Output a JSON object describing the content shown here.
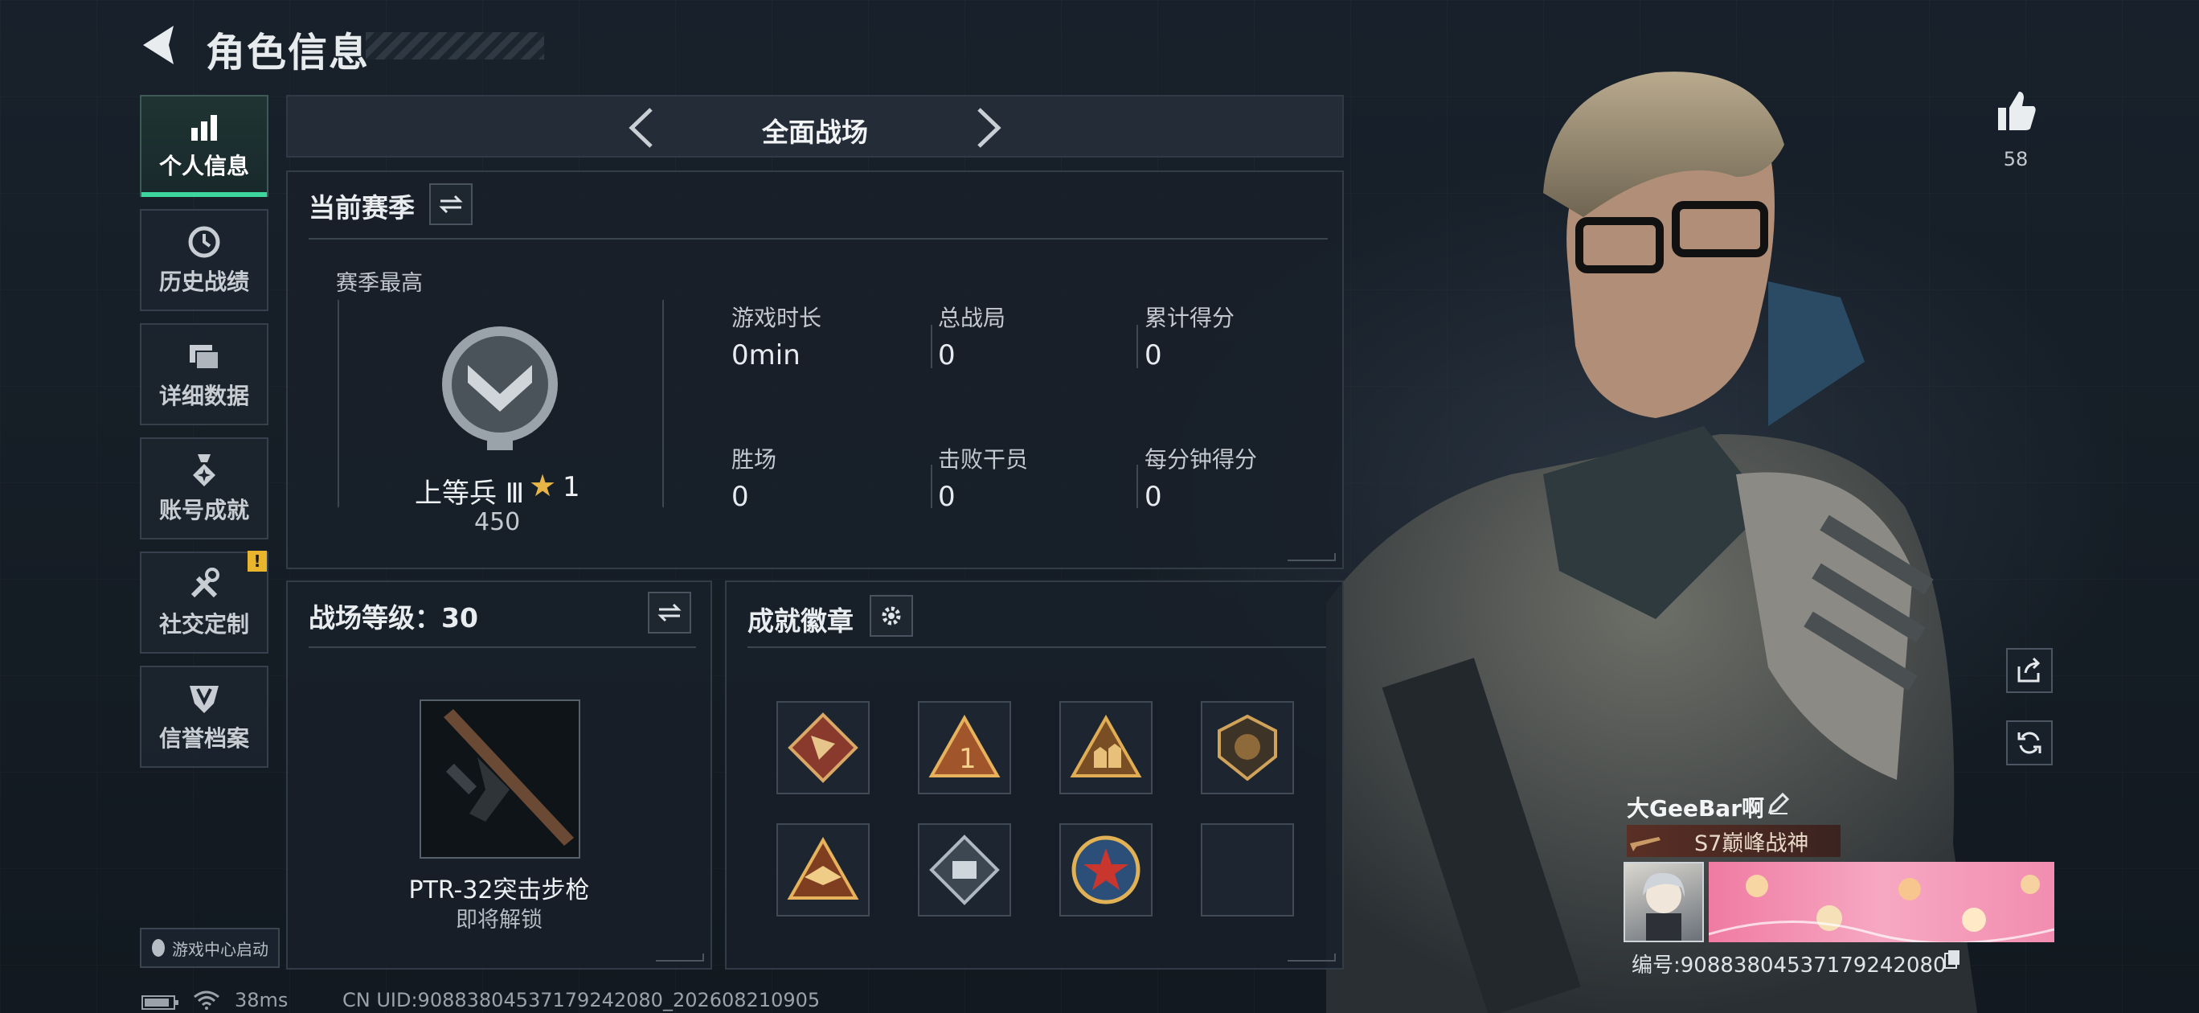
{
  "header": {
    "title": "角色信息"
  },
  "sidebar": {
    "items": [
      {
        "label": "个人信息",
        "icon": "bar-chart-icon",
        "active": true
      },
      {
        "label": "历史战绩",
        "icon": "history-clock-icon"
      },
      {
        "label": "详细数据",
        "icon": "folder-stack-icon"
      },
      {
        "label": "账号成就",
        "icon": "achievement-medal-icon"
      },
      {
        "label": "社交定制",
        "icon": "wrench-tools-icon",
        "alert": "!"
      },
      {
        "label": "信誉档案",
        "icon": "shield-emblem-icon"
      }
    ],
    "game_center": "游戏中心启动"
  },
  "mode_switcher": {
    "mode": "全面战场"
  },
  "season": {
    "title": "当前赛季",
    "best_label": "赛季最高",
    "rank_name": "上等兵 Ⅲ",
    "rank_stars": "1",
    "rank_points": "450",
    "stats": [
      {
        "label": "游戏时长",
        "value": "0min"
      },
      {
        "label": "总战局",
        "value": "0"
      },
      {
        "label": "累计得分",
        "value": "0"
      },
      {
        "label": "胜场",
        "value": "0"
      },
      {
        "label": "击败干员",
        "value": "0"
      },
      {
        "label": "每分钟得分",
        "value": "0"
      }
    ]
  },
  "battlefield_level": {
    "title": "战场等级：30",
    "weapon_name": "PTR-32突击步枪",
    "weapon_status": "即将解锁"
  },
  "achievements": {
    "title": "成就徽章",
    "badges": [
      "dragon-badge-icon",
      "triangle-number-one-badge-icon",
      "soldiers-triangle-badge-icon",
      "lion-shield-badge-icon",
      "eagle-emblem-badge-icon",
      "diamond-camera-badge-icon",
      "star-circle-badge-icon",
      "empty-badge-slot"
    ]
  },
  "profile": {
    "likes": "58",
    "player_name": "大GeeBar啊",
    "title_tag": "S7巅峰战神",
    "id_line": "编号:9088380453717924208​0"
  },
  "status_bar": {
    "ping": "38ms",
    "uid": "CN UID:90883804537179242080_202608210905"
  },
  "colors": {
    "accent": "#3fd59f",
    "warning": "#e9b52d",
    "background": "#141b23"
  }
}
